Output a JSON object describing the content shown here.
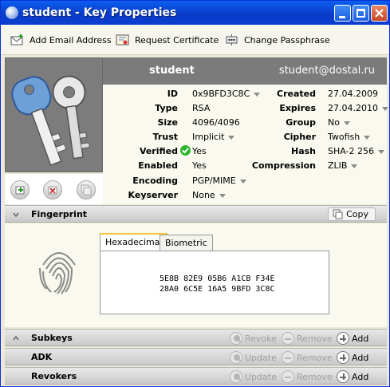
{
  "window": {
    "title": "student - Key Properties"
  },
  "toolbar": {
    "add_email": "Add Email Address",
    "request_certificate": "Request Certificate",
    "change_passphrase": "Change Passphrase"
  },
  "header": {
    "name": "student",
    "email": "student@dostal.ru"
  },
  "props_left": [
    {
      "label": "ID",
      "value": "0x9BFD3C8C",
      "dropdown": true
    },
    {
      "label": "Type",
      "value": "RSA",
      "dropdown": false
    },
    {
      "label": "Size",
      "value": "4096/4096",
      "dropdown": false
    },
    {
      "label": "Trust",
      "value": "Implicit",
      "dropdown": true
    },
    {
      "label": "Verified",
      "value": "Yes",
      "dropdown": false
    },
    {
      "label": "Enabled",
      "value": "Yes",
      "dropdown": false
    },
    {
      "label": "Encoding",
      "value": "PGP/MIME",
      "dropdown": true
    },
    {
      "label": "Keyserver",
      "value": "None",
      "dropdown": true
    }
  ],
  "props_right": [
    {
      "label": "Created",
      "value": "27.04.2009",
      "dropdown": false
    },
    {
      "label": "Expires",
      "value": "27.04.2010",
      "dropdown": true
    },
    {
      "label": "Group",
      "value": "No",
      "dropdown": true
    },
    {
      "label": "Cipher",
      "value": "Twofish",
      "dropdown": true
    },
    {
      "label": "Hash",
      "value": "SHA-2 256",
      "dropdown": true
    },
    {
      "label": "Compression",
      "value": "ZLIB",
      "dropdown": true
    }
  ],
  "fingerprint": {
    "title": "Fingerprint",
    "copy": "Copy",
    "tabs": [
      "Hexadecimal",
      "Biometric"
    ],
    "line1": "5E8B 82E9 05B6 A1CB F34E",
    "line2": "28A0 6C5E 16A5 9BFD 3C8C"
  },
  "sections": [
    {
      "title": "Subkeys",
      "first": "Revoke",
      "second": "Remove",
      "third": "Add"
    },
    {
      "title": "ADK",
      "first": "Update",
      "second": "Remove",
      "third": "Add"
    },
    {
      "title": "Revokers",
      "first": "Update",
      "second": "Remove",
      "third": "Add"
    }
  ],
  "colors": {
    "titlebar": "#0A3BC8",
    "header_band": "#7B7B7B",
    "verified": "#2DB52D"
  }
}
